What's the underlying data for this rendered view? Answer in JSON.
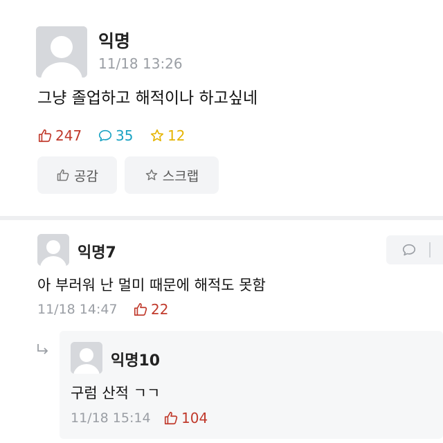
{
  "post": {
    "author": "익명",
    "timestamp": "11/18 13:26",
    "content": "그냥 졸업하고 해적이나 하고싶네",
    "stats": {
      "likes": "247",
      "comments": "35",
      "scraps": "12"
    },
    "buttons": {
      "like_label": "공감",
      "scrap_label": "스크랩"
    }
  },
  "comments": [
    {
      "author": "익명7",
      "content": "아 부러워 난 멀미 때문에 해적도 못함",
      "timestamp": "11/18 14:47",
      "likes": "22",
      "reply": {
        "author": "익명10",
        "content": "구럼 산적 ㄱㄱ",
        "timestamp": "11/18 15:14",
        "likes": "104"
      }
    }
  ],
  "colors": {
    "like": "#c0392b",
    "comment": "#1aa3c3",
    "scrap": "#e5b400"
  },
  "icons": {
    "like": "thumbs-up-icon",
    "comment": "speech-bubble-icon",
    "scrap": "star-icon",
    "reply": "reply-arrow-icon"
  }
}
